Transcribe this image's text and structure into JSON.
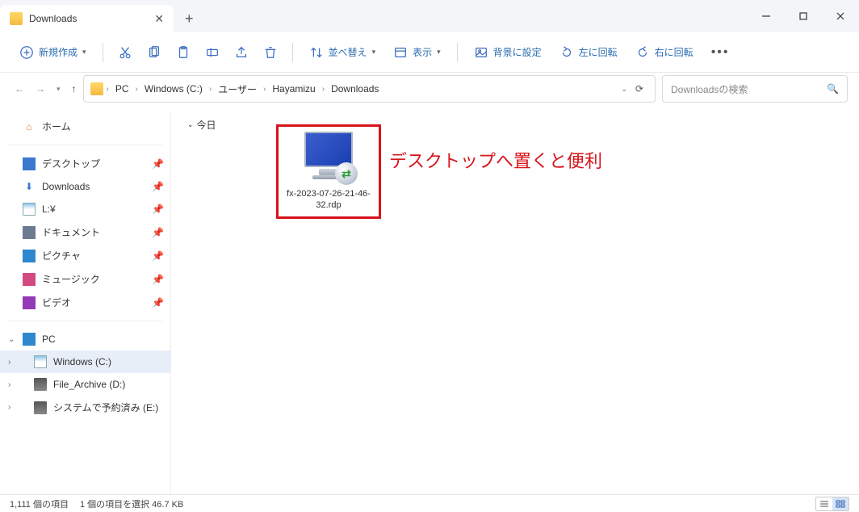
{
  "tab": {
    "title": "Downloads"
  },
  "toolbar": {
    "new": "新規作成",
    "sort": "並べ替え",
    "view": "表示",
    "setbg": "背景に設定",
    "rotleft": "左に回転",
    "rotright": "右に回転"
  },
  "breadcrumbs": [
    "PC",
    "Windows (C:)",
    "ユーザー",
    "Hayamizu",
    "Downloads"
  ],
  "search": {
    "placeholder": "Downloadsの検索"
  },
  "sidebar": {
    "home": "ホーム",
    "quick": [
      {
        "label": "デスクトップ",
        "icon": "desk-ico"
      },
      {
        "label": "Downloads",
        "icon": "dl-ico"
      },
      {
        "label": "L:¥",
        "icon": "drive-ico"
      },
      {
        "label": "ドキュメント",
        "icon": "doc-ico"
      },
      {
        "label": "ピクチャ",
        "icon": "pic-ico"
      },
      {
        "label": "ミュージック",
        "icon": "music-ico"
      },
      {
        "label": "ビデオ",
        "icon": "video-ico"
      }
    ],
    "pc": "PC",
    "drives": [
      {
        "label": "Windows (C:)"
      },
      {
        "label": "File_Archive (D:)"
      },
      {
        "label": "システムで予約済み (E:)"
      }
    ]
  },
  "content": {
    "group": "今日",
    "file_name": "fx-2023-07-26-21-46-32.rdp",
    "annotation": "デスクトップへ置くと便利"
  },
  "status": {
    "count": "1,111 個の項目",
    "selection": "1 個の項目を選択 46.7 KB"
  }
}
